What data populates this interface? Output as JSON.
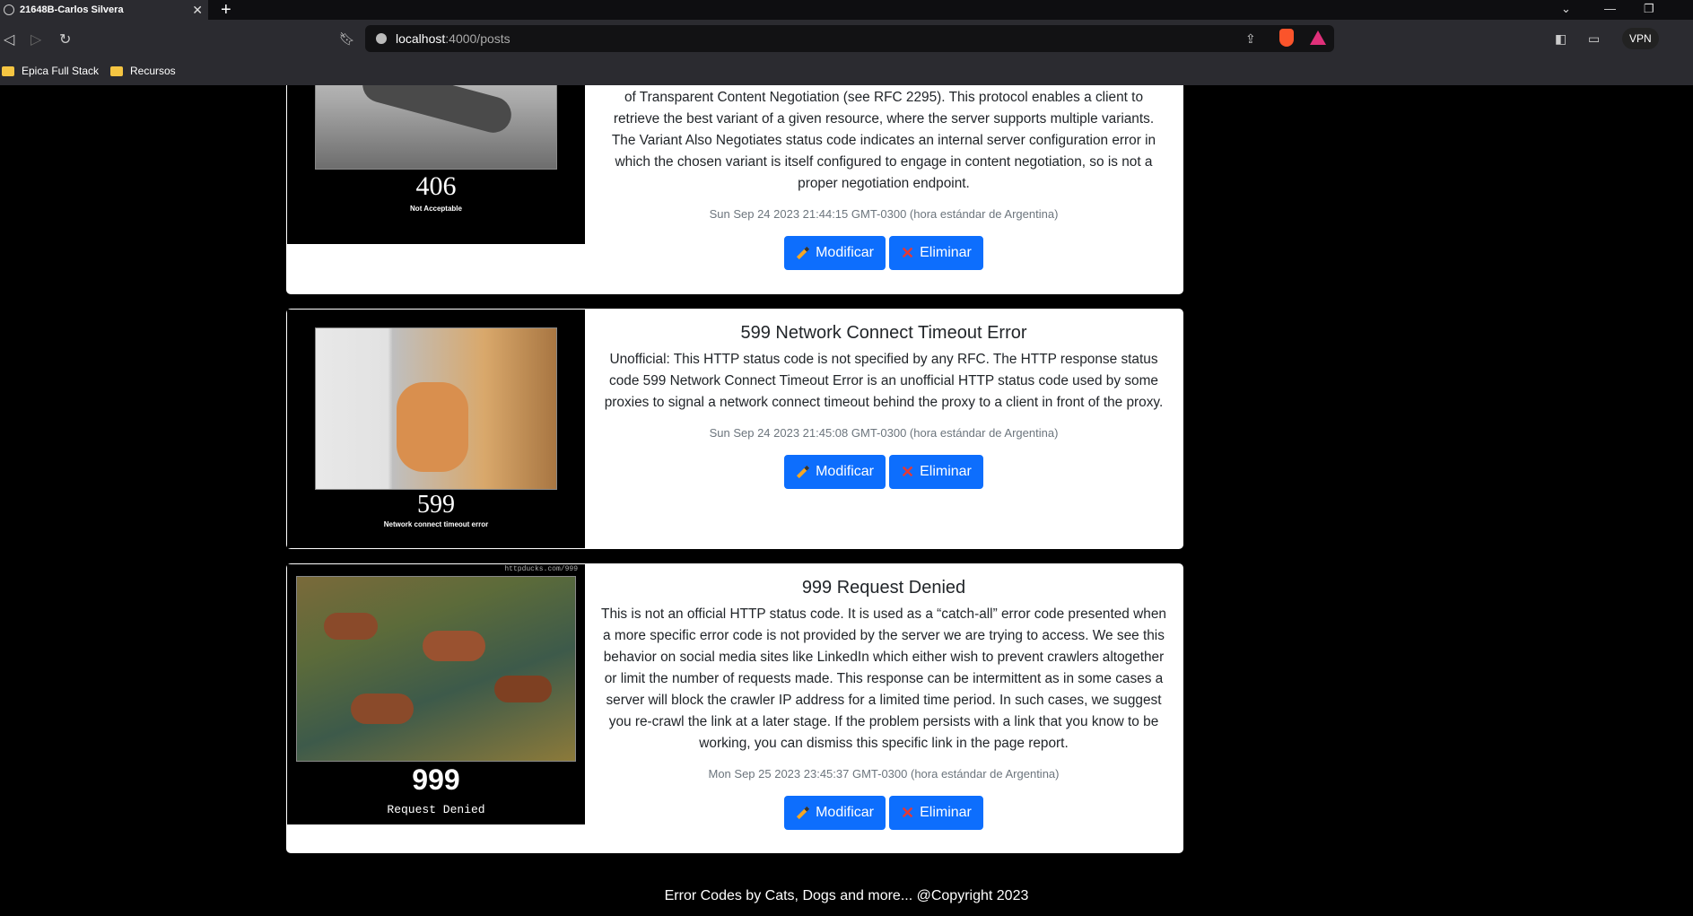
{
  "browser": {
    "tab_title": "21648B-Carlos Silvera",
    "url_host": "localhost",
    "url_path": ":4000/posts",
    "bookmarks": [
      "Epica Full Stack",
      "Recursos"
    ],
    "vpn_label": "VPN"
  },
  "posts": [
    {
      "image_code": "406",
      "image_caption": "Not Acceptable",
      "title": "",
      "description": "of Transparent Content Negotiation (see RFC 2295). This protocol enables a client to retrieve the best variant of a given resource, where the server supports multiple variants. The Variant Also Negotiates status code indicates an internal server configuration error in which the chosen variant is itself configured to engage in content negotiation, so is not a proper negotiation endpoint.",
      "date": "Sun Sep 24 2023 21:44:15 GMT-0300 (hora estándar de Argentina)"
    },
    {
      "image_code": "599",
      "image_caption": "Network connect timeout error",
      "title": "599 Network Connect Timeout Error",
      "description": "Unofficial: This HTTP status code is not specified by any RFC. The HTTP response status code 599 Network Connect Timeout Error is an unofficial HTTP status code used by some proxies to signal a network connect timeout behind the proxy to a client in front of the proxy.",
      "date": "Sun Sep 24 2023 21:45:08 GMT-0300 (hora estándar de Argentina)"
    },
    {
      "image_code": "999",
      "image_caption": "Request Denied",
      "image_watermark": "httpducks.com/999",
      "title": "999 Request Denied",
      "description": "This is not an official HTTP status code. It is used as a “catch-all” error code presented when a more specific error code is not provided by the server we are trying to access. We see this behavior on social media sites like LinkedIn which either wish to prevent crawlers altogether or limit the number of requests made. This response can be intermittent as in some cases a server will block the crawler IP address for a limited time period. In such cases, we suggest you re-crawl the link at a later stage. If the problem persists with a link that you know to be working, you can dismiss this specific link in the page report.",
      "date": "Mon Sep 25 2023 23:45:37 GMT-0300 (hora estándar de Argentina)"
    }
  ],
  "buttons": {
    "modify": "Modificar",
    "delete": "Eliminar"
  },
  "footer": "Error Codes by Cats, Dogs and more... @Copyright 2023",
  "colors": {
    "primary": "#0d6efd",
    "page_bg": "#000000"
  }
}
